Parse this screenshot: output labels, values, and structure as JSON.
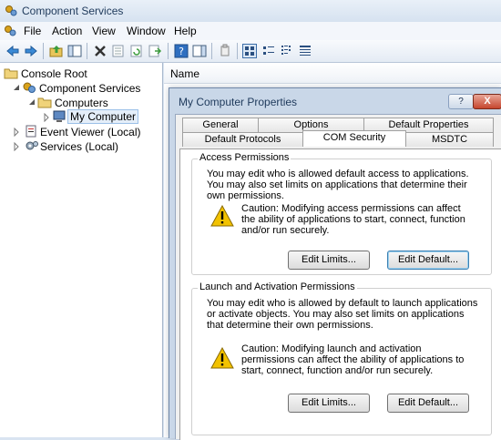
{
  "window": {
    "title": "Component Services"
  },
  "menu": [
    "File",
    "Action",
    "View",
    "Window",
    "Help"
  ],
  "toolbar": [
    "back-icon",
    "forward-icon",
    "up-folder-icon",
    "show-hide-tree-icon",
    "delete-icon",
    "properties-icon",
    "refresh-icon",
    "export-list-icon",
    "help-icon",
    "show-hide-action-pane-icon",
    "configure-icon",
    "large-icons-view-icon",
    "small-icons-view-icon",
    "list-view-icon",
    "detail-view-icon"
  ],
  "tree": {
    "items": [
      {
        "label": "Console Root"
      },
      {
        "label": "Component Services"
      },
      {
        "label": "Computers"
      },
      {
        "label": "My Computer",
        "selected": true
      },
      {
        "label": "Event Viewer (Local)"
      },
      {
        "label": "Services (Local)"
      }
    ]
  },
  "list": {
    "column_name": "Name"
  },
  "dialog": {
    "title": "My Computer Properties",
    "help_label": "?",
    "close_label": "X",
    "tabs_row1": [
      "General",
      "Options",
      "Default Properties"
    ],
    "tabs_row2": [
      "Default Protocols",
      "COM Security",
      "MSDTC"
    ],
    "active_tab": "COM Security",
    "access": {
      "title": "Access Permissions",
      "description": "You may edit who is allowed default access to applications. You may also set limits on applications that determine their own permissions.",
      "caution": "Caution: Modifying access permissions can affect the ability of applications to start, connect, function and/or run securely.",
      "edit_limits": "Edit Limits...",
      "edit_default": "Edit Default..."
    },
    "launch": {
      "title": "Launch and Activation Permissions",
      "description": "You may edit who is allowed by default to launch applications or activate objects. You may also set limits on applications that determine their own permissions.",
      "caution": "Caution: Modifying launch and activation permissions can affect the ability of applications to start, connect, function and/or run securely.",
      "edit_limits": "Edit Limits...",
      "edit_default": "Edit Default..."
    }
  },
  "colors": {
    "accent": "#3c7fb1",
    "warning": "#f2c200",
    "close": "#c6452d"
  }
}
